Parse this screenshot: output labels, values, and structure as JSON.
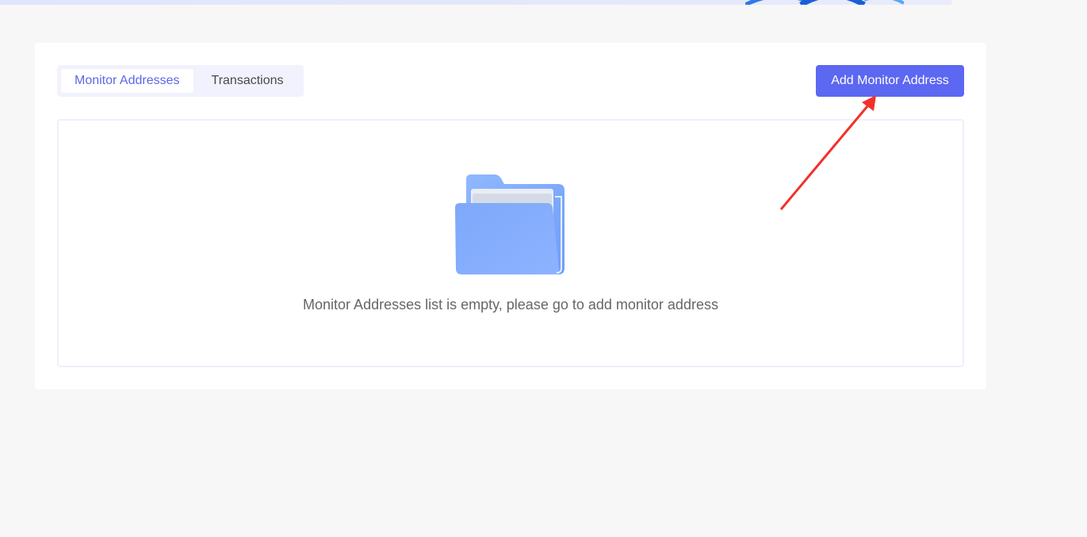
{
  "tabs": {
    "monitor_addresses": "Monitor Addresses",
    "transactions": "Transactions"
  },
  "actions": {
    "add_monitor_address": "Add Monitor Address"
  },
  "empty_state": {
    "icon": "folder-icon",
    "message": "Monitor Addresses list is empty, please go to add monitor address"
  },
  "colors": {
    "accent": "#5c67f2",
    "active_tab_text": "#5b67e6",
    "annotation_arrow": "#f2312a"
  }
}
